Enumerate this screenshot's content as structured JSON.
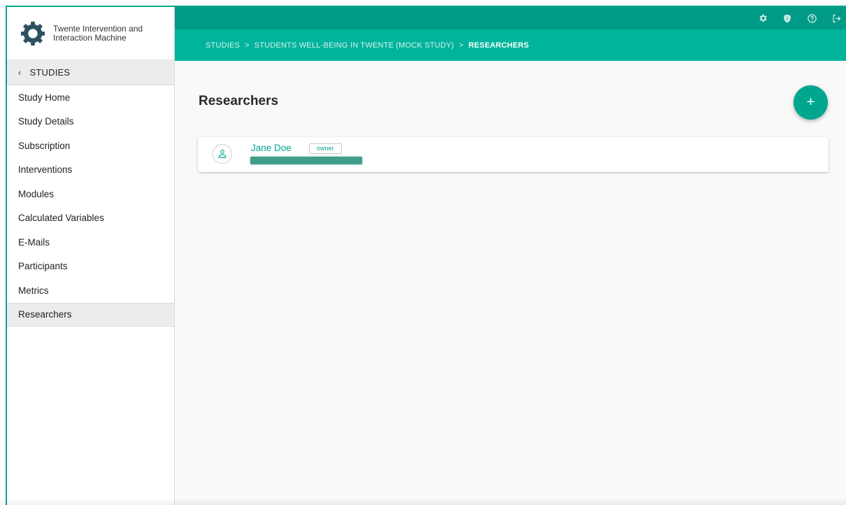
{
  "app": {
    "name_line1": "Twente Intervention and",
    "name_line2": "Interaction Machine"
  },
  "sidebar": {
    "back_label": "STUDIES",
    "items": [
      {
        "label": "Study Home"
      },
      {
        "label": "Study Details"
      },
      {
        "label": "Subscription"
      },
      {
        "label": "Interventions"
      },
      {
        "label": "Modules"
      },
      {
        "label": "Calculated Variables"
      },
      {
        "label": "E-Mails"
      },
      {
        "label": "Participants"
      },
      {
        "label": "Metrics"
      },
      {
        "label": "Researchers",
        "active": true
      }
    ]
  },
  "header": {
    "icons": [
      "gear-icon",
      "shield-icon",
      "help-icon",
      "logout-icon"
    ],
    "breadcrumb": {
      "part1": "STUDIES",
      "separator": ">",
      "part2": "STUDENTS WELL-BEING IN TWENTE (MOCK STUDY)",
      "current": "RESEARCHERS"
    }
  },
  "main": {
    "title": "Researchers",
    "add_button_label": "+",
    "researchers": [
      {
        "name": "Jane Doe",
        "role": "owner",
        "email_redacted": true
      }
    ]
  },
  "colors": {
    "accent": "#00a78f",
    "topbar": "#009b87",
    "breadcrumb_bar": "#00b39b"
  }
}
